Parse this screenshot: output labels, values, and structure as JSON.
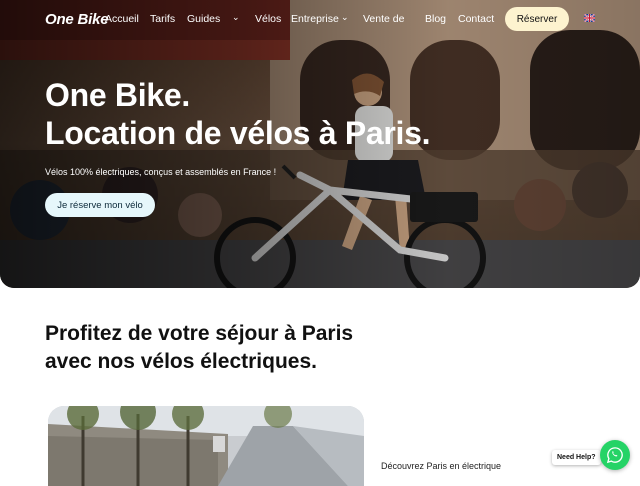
{
  "nav": {
    "logo": "One Bike",
    "links": [
      "Accueil",
      "Tarifs",
      "Guides",
      "Vélos",
      "Entreprise",
      "Vente de",
      "Blog",
      "Contact"
    ],
    "reserve_label": "Réserver",
    "language_icon": "uk-flag-icon"
  },
  "hero": {
    "title_line1": "One Bike.",
    "title_line2": "Location de vélos à Paris.",
    "subtitle": "Vélos 100% électriques, conçus et assemblés en France !",
    "cta_label": "Je réserve mon vélo"
  },
  "section": {
    "title_line1": "Profitez de votre séjour à Paris",
    "title_line2": "avec nos vélos électriques.",
    "discover": "Découvrez Paris en électrique"
  },
  "help": {
    "label": "Need Help?",
    "icon": "whatsapp-icon",
    "color": "#25d366"
  },
  "colors": {
    "reserve_bg": "#fdf3cf",
    "cta_bg": "#e6f7fb"
  }
}
